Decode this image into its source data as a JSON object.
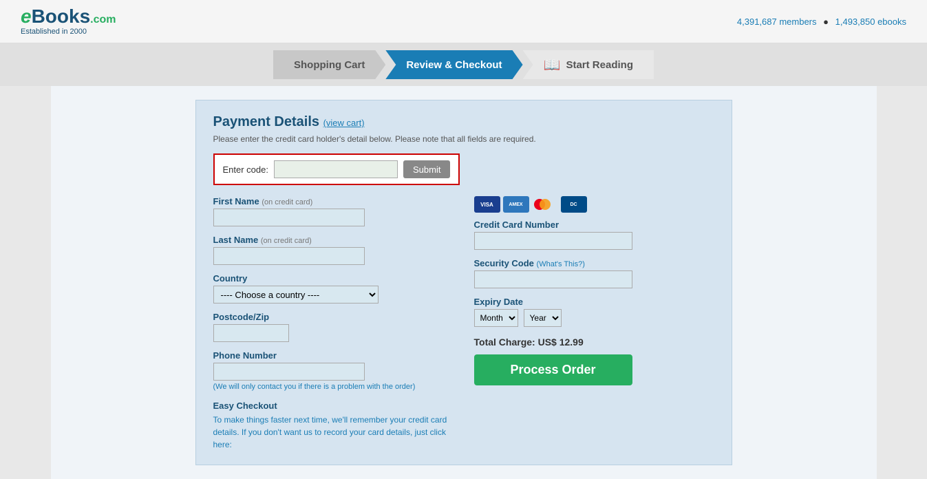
{
  "header": {
    "logo_e": "e",
    "logo_books": "Books",
    "logo_com": ".com",
    "logo_established": "Established in 2000",
    "members": "4,391,687 members",
    "ebooks": "1,493,850 ebooks"
  },
  "steps": {
    "step1_label": "Shopping Cart",
    "step2_label": "Review & Checkout",
    "step3_label": "Start Reading"
  },
  "payment": {
    "title": "Payment Details",
    "view_cart": "(view cart)",
    "subtitle": "Please enter the credit card holder's detail below. Please note that all fields are required.",
    "promo_label": "Enter code:",
    "promo_placeholder": "",
    "promo_submit": "Submit",
    "first_name_label": "First Name",
    "first_name_note": "(on credit card)",
    "last_name_label": "Last Name",
    "last_name_note": "(on credit card)",
    "country_label": "Country",
    "country_default": "---- Choose a country ----",
    "postcode_label": "Postcode/Zip",
    "phone_label": "Phone Number",
    "phone_note": "(We will only contact you if there is a problem with the order)",
    "cc_number_label": "Credit Card Number",
    "security_label": "Security Code",
    "whats_this": "(What's This?)",
    "expiry_label": "Expiry Date",
    "expiry_month": "Month",
    "expiry_year": "Year",
    "total_label": "Total Charge: US$ 12.99",
    "process_btn": "Process Order",
    "easy_checkout_title": "Easy Checkout",
    "easy_checkout_text": "To make things faster next time, we'll remember your credit card details. If you don't want us to record your card details, just click here:"
  }
}
